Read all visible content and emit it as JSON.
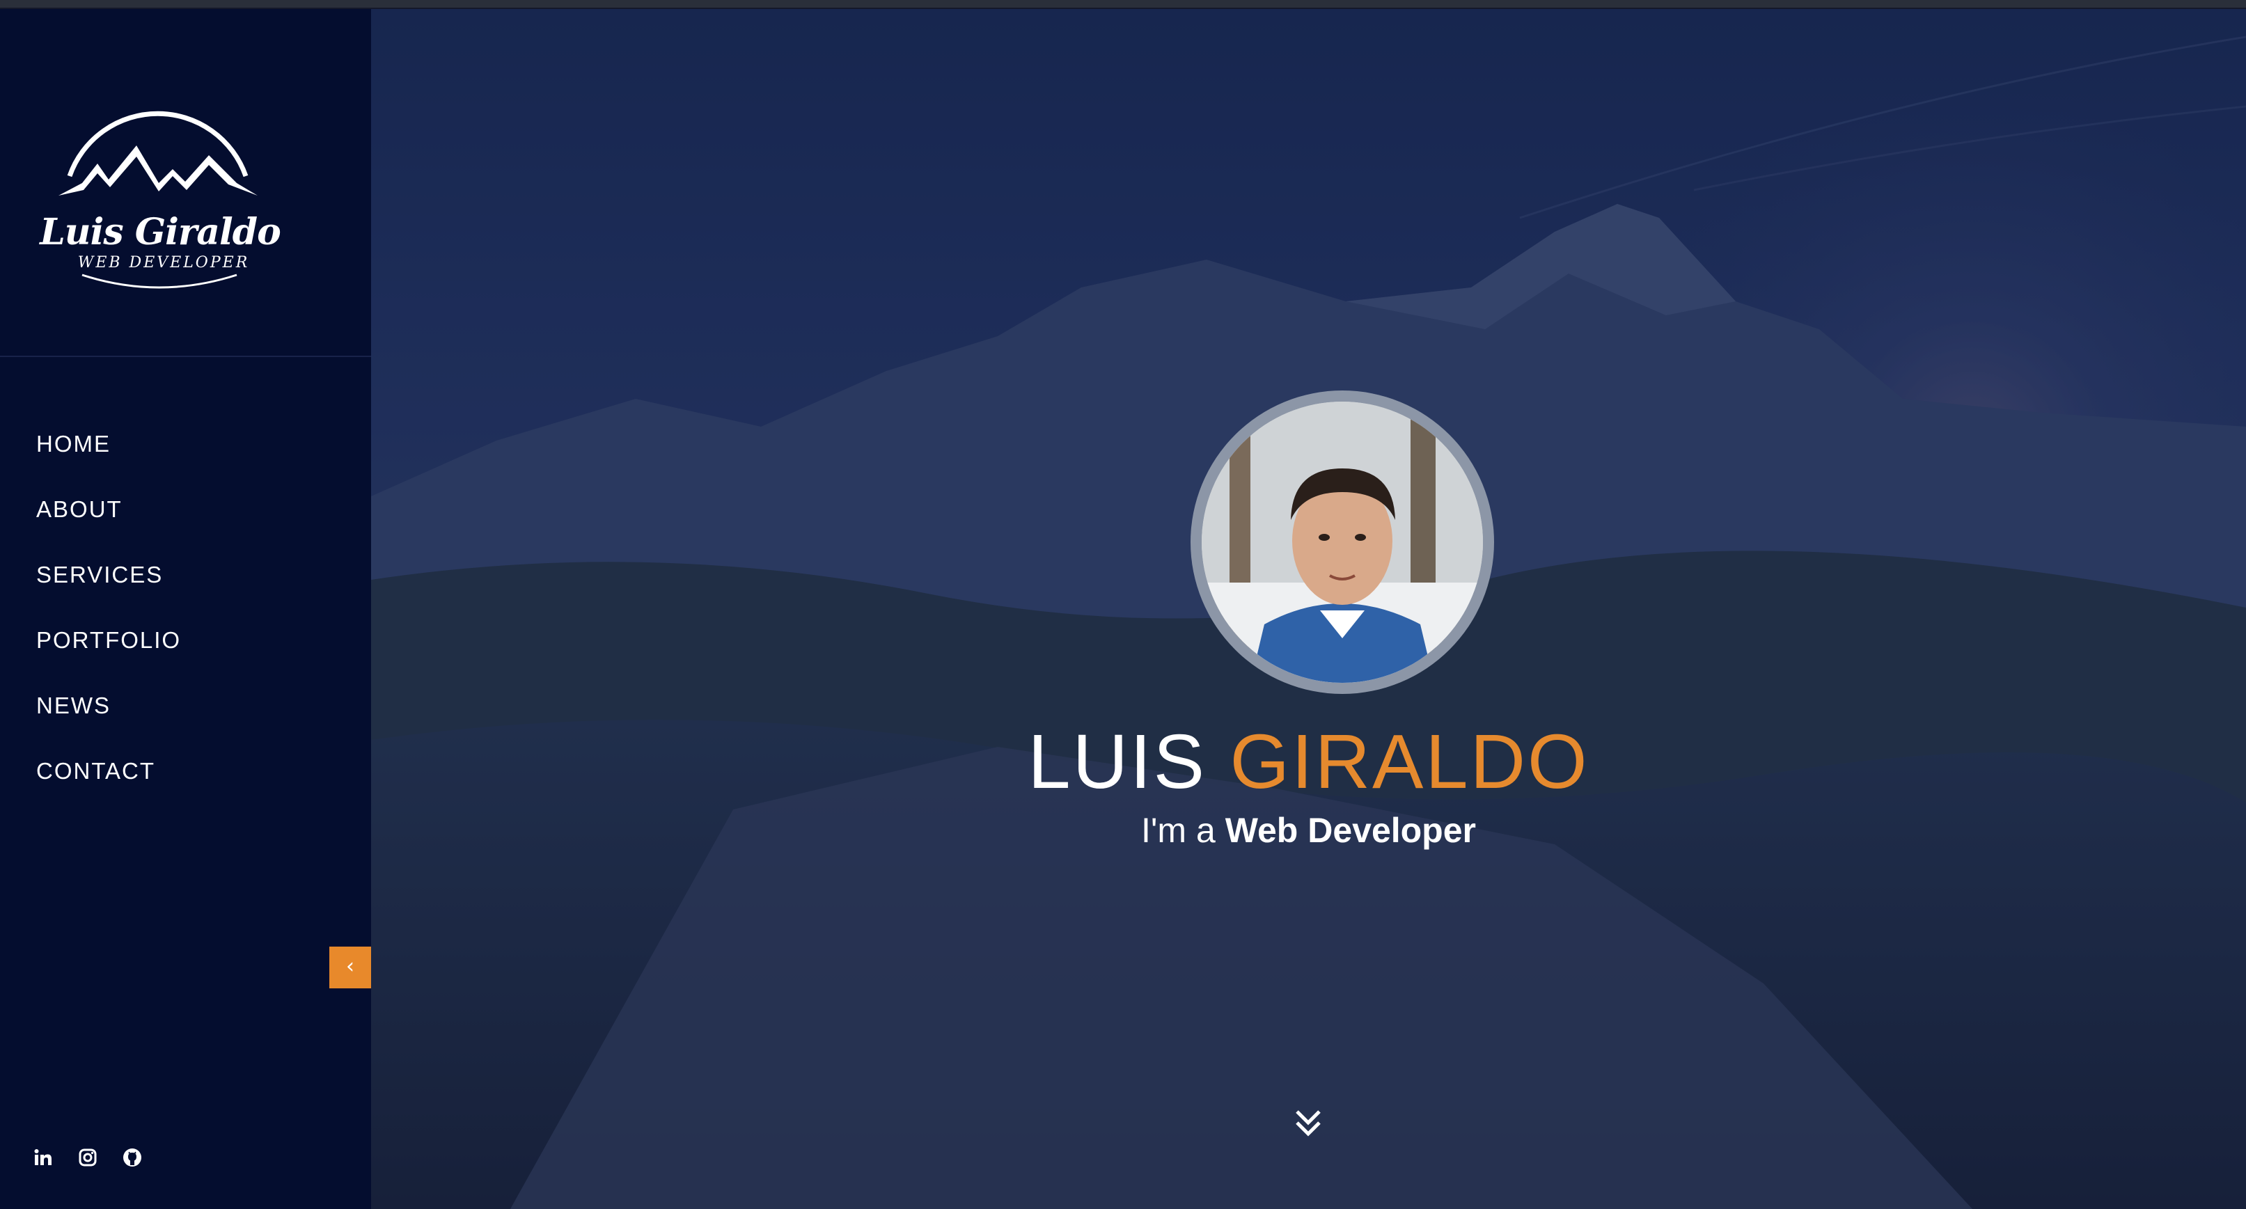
{
  "sidebar": {
    "logo": {
      "name": "Luis Giraldo",
      "tagline": "WEB DEVELOPER"
    },
    "nav": [
      {
        "label": "HOME"
      },
      {
        "label": "ABOUT"
      },
      {
        "label": "SERVICES"
      },
      {
        "label": "PORTFOLIO"
      },
      {
        "label": "NEWS"
      },
      {
        "label": "CONTACT"
      }
    ],
    "collapse_icon": "chevron-left-icon",
    "social": [
      "linkedin-icon",
      "instagram-icon",
      "github-icon"
    ]
  },
  "hero": {
    "first_name": "LUIS",
    "last_name": "GIRALDO",
    "intro": "I'm a",
    "role": "Web Developer",
    "scroll_icon": "double-chevron-down-icon"
  },
  "colors": {
    "sidebar_bg": "#040d2f",
    "accent": "#e68a2e",
    "text": "#ffffff"
  }
}
